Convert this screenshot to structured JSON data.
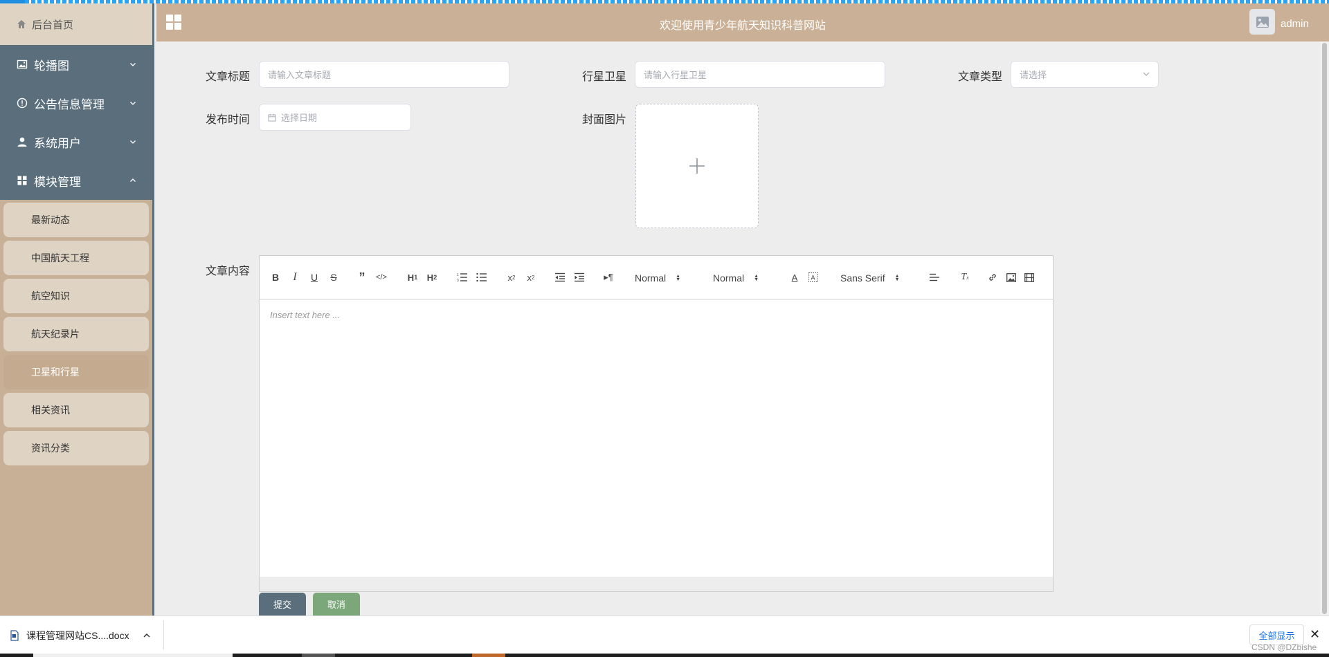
{
  "sidebar": {
    "home_label": "后台首页",
    "menus": [
      {
        "label": "轮播图",
        "icon": "picture-icon",
        "expanded": false
      },
      {
        "label": "公告信息管理",
        "icon": "info-icon",
        "expanded": false
      },
      {
        "label": "系统用户",
        "icon": "user-icon",
        "expanded": false
      },
      {
        "label": "模块管理",
        "icon": "grid-icon",
        "expanded": true
      }
    ],
    "sub_items": [
      {
        "label": "最新动态"
      },
      {
        "label": "中国航天工程"
      },
      {
        "label": "航空知识"
      },
      {
        "label": "航天纪录片"
      },
      {
        "label": "卫星和行星",
        "active": true
      },
      {
        "label": "相关资讯"
      },
      {
        "label": "资讯分类"
      }
    ]
  },
  "header": {
    "title": "欢迎使用青少年航天知识科普网站",
    "username": "admin"
  },
  "form": {
    "title_label": "文章标题",
    "title_placeholder": "请输入文章标题",
    "planet_label": "行星卫星",
    "planet_placeholder": "请输入行星卫星",
    "type_label": "文章类型",
    "type_placeholder": "请选择",
    "date_label": "发布时间",
    "date_placeholder": "选择日期",
    "cover_label": "封面图片",
    "content_label": "文章内容"
  },
  "editor": {
    "header_select": "Normal",
    "size_select": "Normal",
    "font_select": "Sans Serif",
    "placeholder": "Insert text here ..."
  },
  "buttons": {
    "submit": "提交",
    "cancel": "取消"
  },
  "downloads": {
    "file_name": "课程管理网站CS....docx",
    "show_all": "全部显示",
    "close": "✕"
  },
  "watermark": "CSDN @DZbishe",
  "colors": {
    "sidebar_dark": "#5a6e7c",
    "sidebar_tan": "#c8b097",
    "header_tan": "#c9b096",
    "submit_btn": "#5a6e7c",
    "cancel_btn": "#7ba77a"
  }
}
